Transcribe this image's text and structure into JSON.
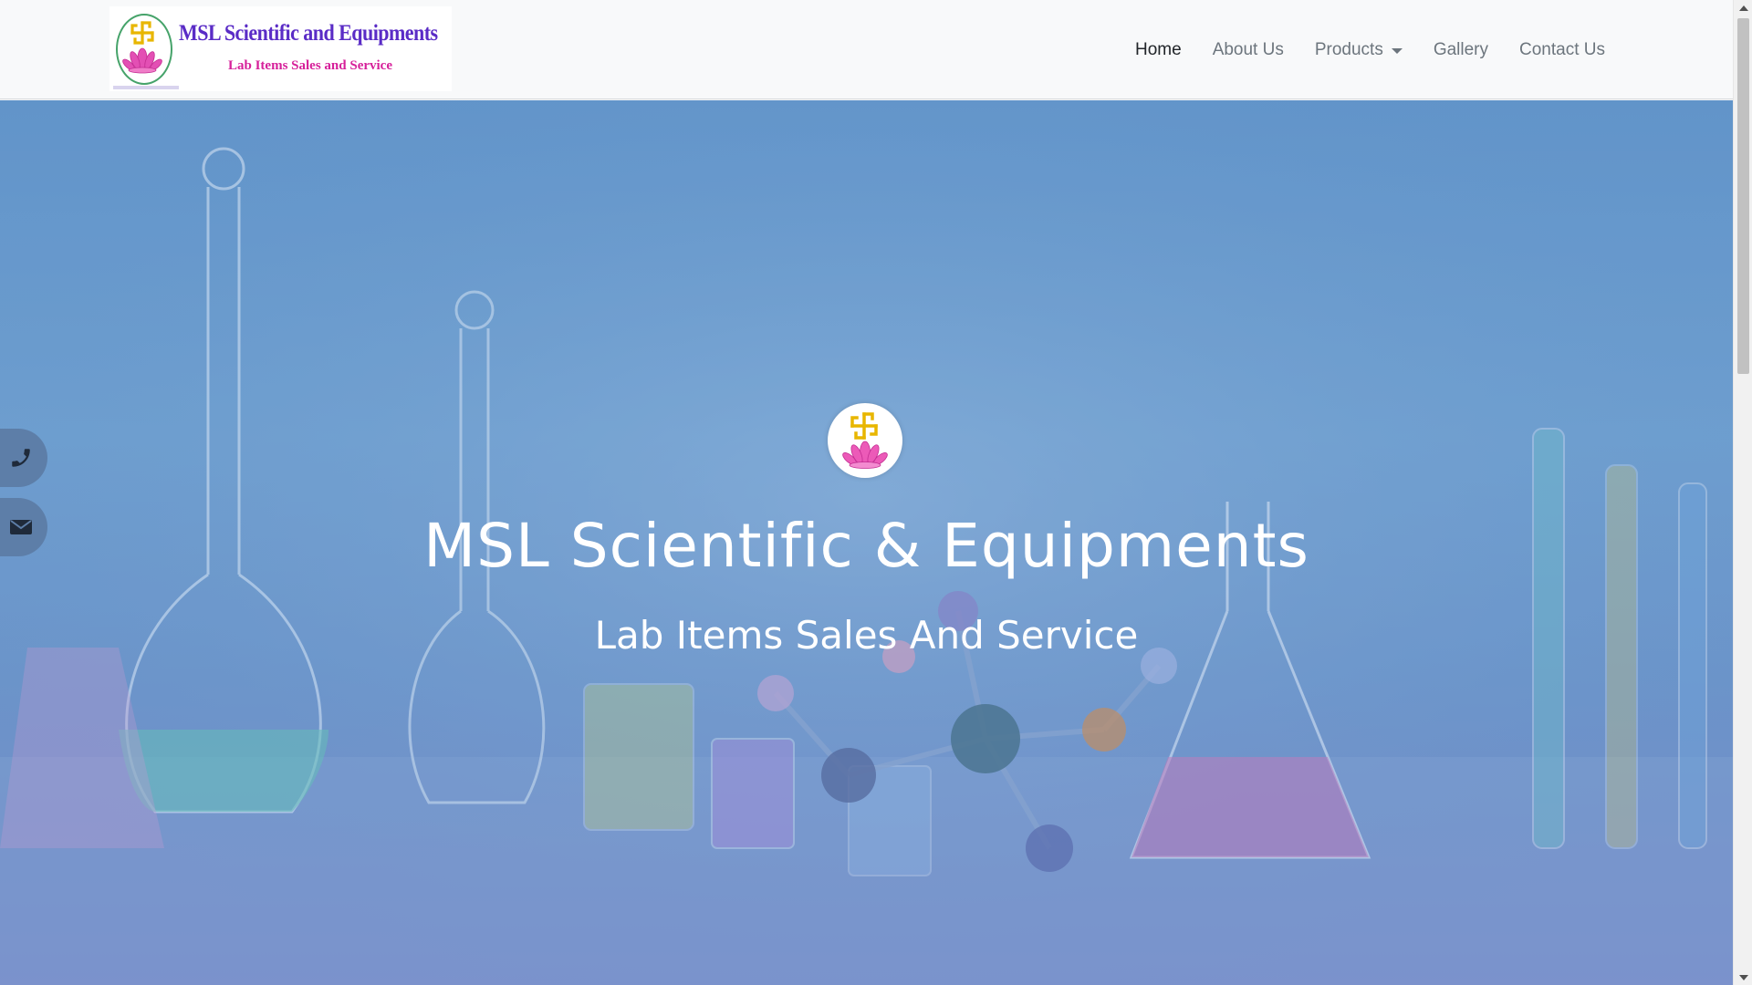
{
  "brand": {
    "title": "MSL Scientific and Equipments",
    "subtitle": "Lab Items Sales and Service"
  },
  "nav": {
    "items": [
      {
        "label": "Home",
        "active": true
      },
      {
        "label": "About Us",
        "active": false
      },
      {
        "label": "Products",
        "active": false,
        "dropdown": true
      },
      {
        "label": "Gallery",
        "active": false
      },
      {
        "label": "Contact Us",
        "active": false
      }
    ]
  },
  "hero": {
    "title": "MSL Scientific & Equipments",
    "subtitle": "Lab Items Sales And Service",
    "background": "laboratory-glassware-photo"
  },
  "floating": {
    "phone_icon": "phone-icon",
    "mail_icon": "envelope-icon"
  },
  "colors": {
    "brand_purple": "#5a2cc6",
    "brand_pink": "#d6209a",
    "nav_text": "#6c757d",
    "nav_active": "#212529",
    "hero_overlay": "#6a97cd",
    "float_button": "#5d7ea8"
  }
}
